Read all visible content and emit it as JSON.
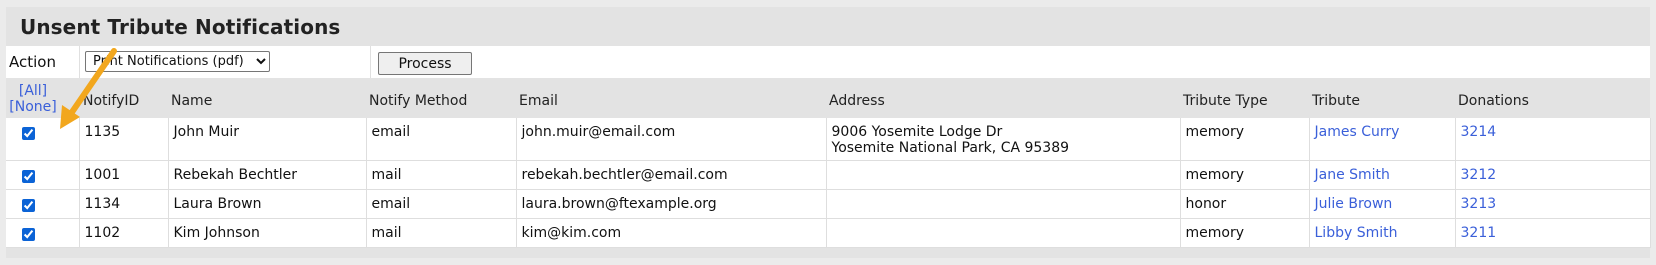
{
  "title": "Unsent Tribute Notifications",
  "action": {
    "label": "Action",
    "selected": "Print Notifications (pdf)",
    "process_label": "Process"
  },
  "select_links": {
    "all": "[All]",
    "none": "[None]"
  },
  "columns": {
    "notify_id": "NotifyID",
    "name": "Name",
    "notify_method": "Notify Method",
    "email": "Email",
    "address": "Address",
    "tribute_type": "Tribute Type",
    "tribute": "Tribute",
    "donations": "Donations"
  },
  "rows": [
    {
      "checked": true,
      "notify_id": "1135",
      "name": "John Muir",
      "notify_method": "email",
      "email": "john.muir@email.com",
      "address_line1": "9006 Yosemite Lodge Dr",
      "address_line2": "Yosemite National Park, CA 95389",
      "tribute_type": "memory",
      "tribute": "James Curry",
      "donations": "3214"
    },
    {
      "checked": true,
      "notify_id": "1001",
      "name": "Rebekah Bechtler",
      "notify_method": "mail",
      "email": "rebekah.bechtler@email.com",
      "address_line1": "",
      "address_line2": "",
      "tribute_type": "memory",
      "tribute": "Jane Smith",
      "donations": "3212"
    },
    {
      "checked": true,
      "notify_id": "1134",
      "name": "Laura Brown",
      "notify_method": "email",
      "email": "laura.brown@ftexample.org",
      "address_line1": "",
      "address_line2": "",
      "tribute_type": "honor",
      "tribute": "Julie Brown",
      "donations": "3213"
    },
    {
      "checked": true,
      "notify_id": "1102",
      "name": "Kim Johnson",
      "notify_method": "mail",
      "email": "kim@kim.com",
      "address_line1": "",
      "address_line2": "",
      "tribute_type": "memory",
      "tribute": "Libby Smith",
      "donations": "3211"
    }
  ],
  "colors": {
    "link": "#3a5fd9",
    "arrow": "#f2a71e",
    "panel": "#e3e3e3"
  },
  "icons": {
    "annotation": "arrow-pointer-icon"
  }
}
